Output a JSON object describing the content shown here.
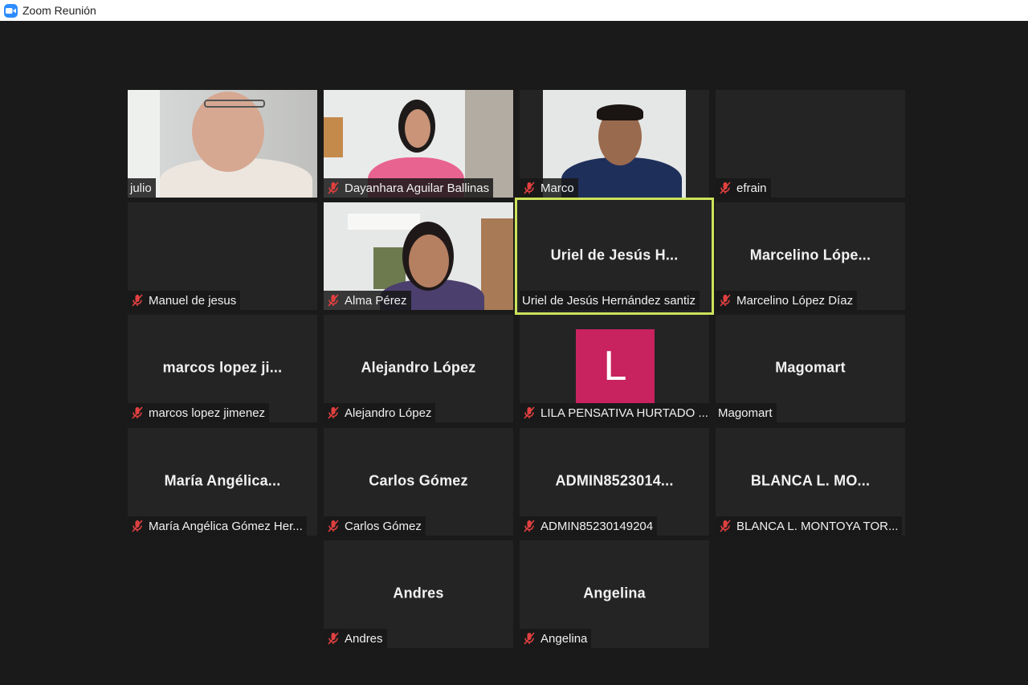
{
  "window": {
    "title": "Zoom Reunión",
    "logo_icon": "zoom-camera-icon"
  },
  "colors": {
    "active_border": "#cce35a",
    "mute": "#e04040",
    "avatar_bg": "#c8235e"
  },
  "participants": [
    {
      "label": "julio",
      "muted": false,
      "video": true
    },
    {
      "label": "Dayanhara Aguilar Ballinas",
      "muted": true,
      "video": true
    },
    {
      "label": "Marco",
      "muted": true,
      "video": true
    },
    {
      "label": "efrain",
      "muted": true,
      "video": false,
      "display_name": ""
    },
    {
      "label": "Manuel de jesus",
      "muted": true,
      "video": false,
      "display_name": ""
    },
    {
      "label": "Alma Pérez",
      "muted": true,
      "video": true
    },
    {
      "label": "Uriel de Jesús Hernández santiz",
      "muted": false,
      "video": false,
      "display_name": "Uriel de Jesús H...",
      "active_speaker": true
    },
    {
      "label": "Marcelino López Díaz",
      "muted": true,
      "video": false,
      "display_name": "Marcelino  Lópe..."
    },
    {
      "label": "marcos lopez jimenez",
      "muted": true,
      "video": false,
      "display_name": "marcos  lopez  ji..."
    },
    {
      "label": "Alejandro López",
      "muted": true,
      "video": false,
      "display_name": "Alejandro López"
    },
    {
      "label": "LILA PENSATIVA HURTADO ...",
      "muted": true,
      "video": false,
      "avatar_letter": "L"
    },
    {
      "label": "Magomart",
      "muted": false,
      "video": false,
      "display_name": "Magomart"
    },
    {
      "label": "María Angélica Gómez Her...",
      "muted": true,
      "video": false,
      "display_name": "María  Angélica..."
    },
    {
      "label": "Carlos Gómez",
      "muted": true,
      "video": false,
      "display_name": "Carlos Gómez"
    },
    {
      "label": "ADMIN85230149204",
      "muted": true,
      "video": false,
      "display_name": "ADMIN8523014..."
    },
    {
      "label": "BLANCA L. MONTOYA TOR...",
      "muted": true,
      "video": false,
      "display_name": "BLANCA  L.  MO..."
    },
    {
      "label": "Andres",
      "muted": true,
      "video": false,
      "display_name": "Andres"
    },
    {
      "label": "Angelina",
      "muted": true,
      "video": false,
      "display_name": "Angelina"
    }
  ]
}
